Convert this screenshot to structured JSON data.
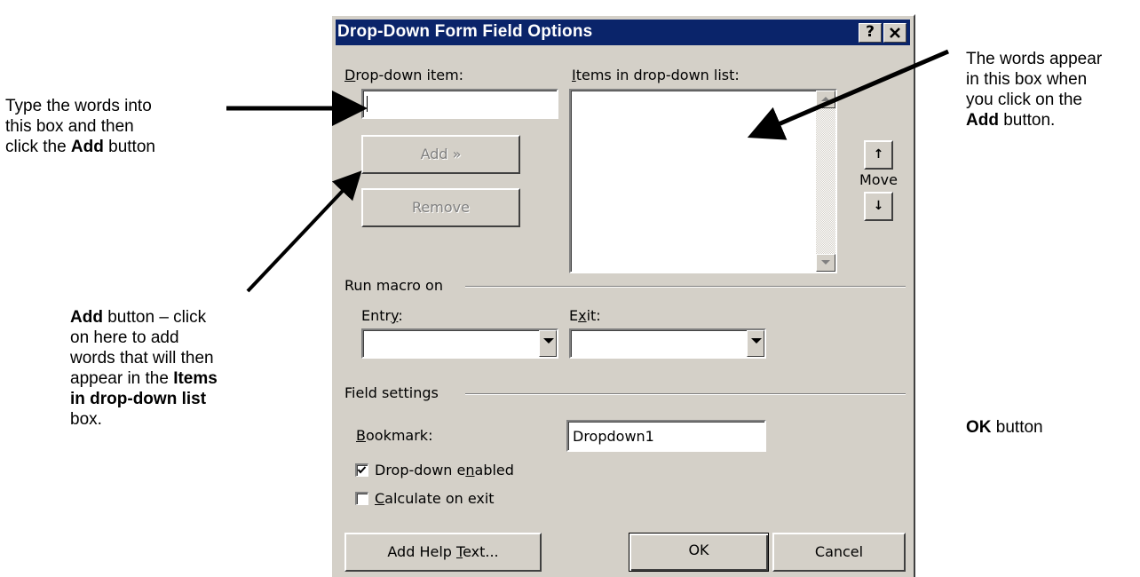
{
  "dialog": {
    "title": "Drop-Down Form Field Options",
    "help_glyph": "?",
    "close_glyph": "✕",
    "dropdown_item_label": {
      "u": "D",
      "rest": "rop-down item:"
    },
    "dropdown_item_value": "",
    "items_label": {
      "u": "I",
      "rest": "tems in drop-down list:"
    },
    "add_button": "Add »",
    "remove_button": "Remove",
    "move_label": "Move",
    "move_up_glyph": "↑",
    "move_down_glyph": "↓",
    "run_macro_on": "Run macro on",
    "entry_label": {
      "pre": "Entr",
      "u": "y",
      "post": ":"
    },
    "exit_label": {
      "pre": "E",
      "u": "x",
      "post": "it:"
    },
    "entry_value": "",
    "exit_value": "",
    "field_settings": "Field settings",
    "bookmark_label": {
      "u": "B",
      "rest": "ookmark:"
    },
    "bookmark_value": "Dropdown1",
    "dropdown_enabled": {
      "pre": "Drop-down e",
      "u": "n",
      "post": "abled",
      "checked": true
    },
    "calculate_on_exit": {
      "u": "C",
      "rest": "alculate on exit",
      "checked": false
    },
    "add_help_text": {
      "pre": "Add Help ",
      "u": "T",
      "post": "ext..."
    },
    "ok_button": "OK",
    "cancel_button": "Cancel"
  },
  "annotations": {
    "left_top": {
      "line1": "Type the words into",
      "line2": "this box and then",
      "line3_pre": "click the ",
      "line3_bold": "Add",
      "line3_post": " button"
    },
    "left_bottom": {
      "bold1": "Add",
      "line1_post": " button – click",
      "line2": "on here to add",
      "line3": "words that will then",
      "line4_pre": "appear in the ",
      "line4_bold": "Items",
      "line5_bold": "in drop-down list",
      "line6": "box."
    },
    "right_top": {
      "line1": "The words appear",
      "line2": "in this box when",
      "line3": "you click on the",
      "line4_bold": "Add",
      "line4_post": " button."
    },
    "right_ok": {
      "bold": "OK",
      "post": " button"
    }
  }
}
